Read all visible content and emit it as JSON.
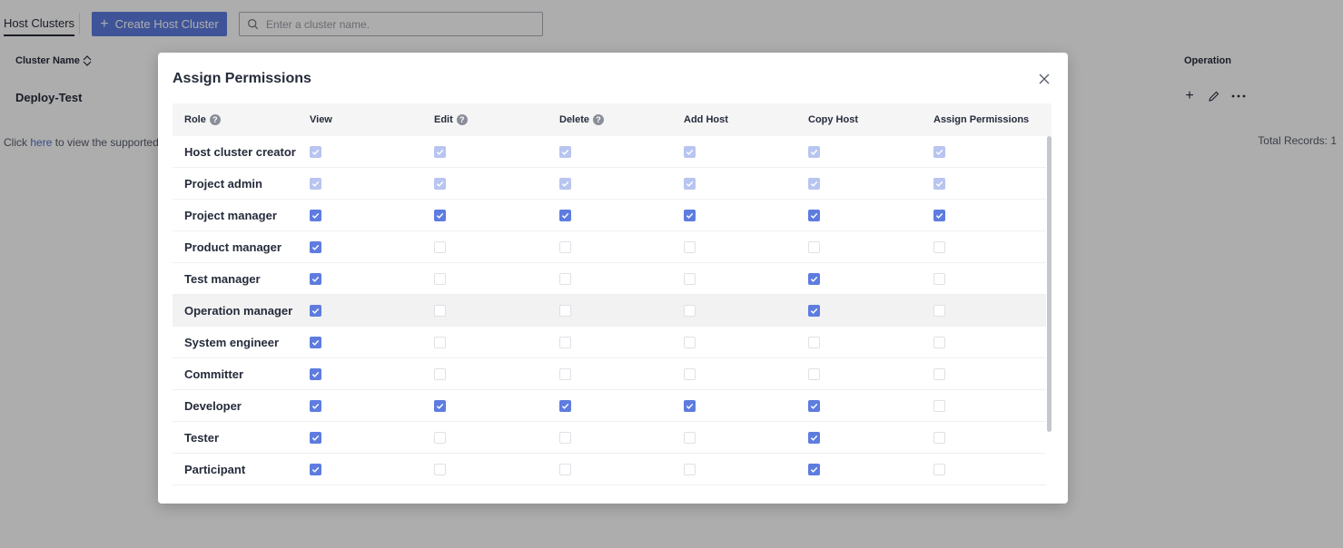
{
  "page": {
    "tab_label": "Host Clusters",
    "create_button_label": "Create Host Cluster",
    "search_placeholder": "Enter a cluster name.",
    "table": {
      "col_cluster_name": "Cluster Name",
      "col_operation": "Operation",
      "rows": [
        {
          "name": "Deploy-Test"
        }
      ]
    },
    "footer": {
      "prefix": "Click ",
      "link": "here",
      "suffix": " to view the supported",
      "total_records": "Total Records: 1"
    }
  },
  "modal": {
    "title": "Assign Permissions",
    "columns": [
      {
        "label": "Role",
        "help": true
      },
      {
        "label": "View",
        "help": false
      },
      {
        "label": "Edit",
        "help": true
      },
      {
        "label": "Delete",
        "help": true
      },
      {
        "label": "Add Host",
        "help": false
      },
      {
        "label": "Copy Host",
        "help": false
      },
      {
        "label": "Assign Permissions",
        "help": false
      }
    ],
    "state_legend": {
      "cd": "checked (disabled)",
      "c": "checked",
      "u": "unchecked",
      "ud": "unchecked (disabled)"
    },
    "rows": [
      {
        "role": "Host cluster creator",
        "perms": [
          "cd",
          "cd",
          "cd",
          "cd",
          "cd",
          "cd"
        ]
      },
      {
        "role": "Project admin",
        "perms": [
          "cd",
          "cd",
          "cd",
          "cd",
          "cd",
          "cd"
        ]
      },
      {
        "role": "Project manager",
        "perms": [
          "c",
          "c",
          "c",
          "c",
          "c",
          "c"
        ]
      },
      {
        "role": "Product manager",
        "perms": [
          "c",
          "u",
          "u",
          "u",
          "u",
          "u"
        ]
      },
      {
        "role": "Test manager",
        "perms": [
          "c",
          "u",
          "u",
          "u",
          "c",
          "u"
        ]
      },
      {
        "role": "Operation manager",
        "perms": [
          "c",
          "u",
          "u",
          "u",
          "c",
          "u"
        ]
      },
      {
        "role": "System engineer",
        "perms": [
          "c",
          "u",
          "u",
          "u",
          "u",
          "u"
        ]
      },
      {
        "role": "Committer",
        "perms": [
          "c",
          "u",
          "u",
          "u",
          "u",
          "u"
        ]
      },
      {
        "role": "Developer",
        "perms": [
          "c",
          "c",
          "c",
          "c",
          "c",
          "u"
        ]
      },
      {
        "role": "Tester",
        "perms": [
          "c",
          "u",
          "u",
          "u",
          "c",
          "u"
        ]
      },
      {
        "role": "Participant",
        "perms": [
          "c",
          "u",
          "u",
          "u",
          "c",
          "u"
        ]
      }
    ],
    "hovered_row": "Operation manager"
  },
  "colors": {
    "accent": "#5e7ce0",
    "accent_disabled": "#b8c5f0",
    "overlay": "rgba(0,0,0,0.32)"
  }
}
